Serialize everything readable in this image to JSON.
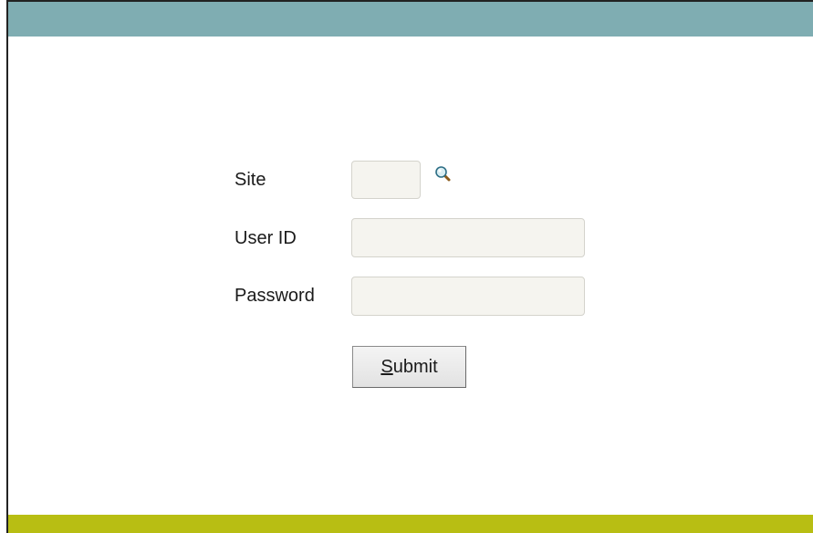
{
  "form": {
    "site_label": "Site",
    "site_value": "",
    "user_id_label": "User ID",
    "user_id_value": "",
    "password_label": "Password",
    "password_value": "",
    "submit_accesskey": "S",
    "submit_rest": "ubmit",
    "lookup_icon": "magnifier-icon"
  },
  "colors": {
    "header_bar": "#7fadb2",
    "footer_bar": "#b8be13",
    "field_background": "#f5f4ef"
  }
}
